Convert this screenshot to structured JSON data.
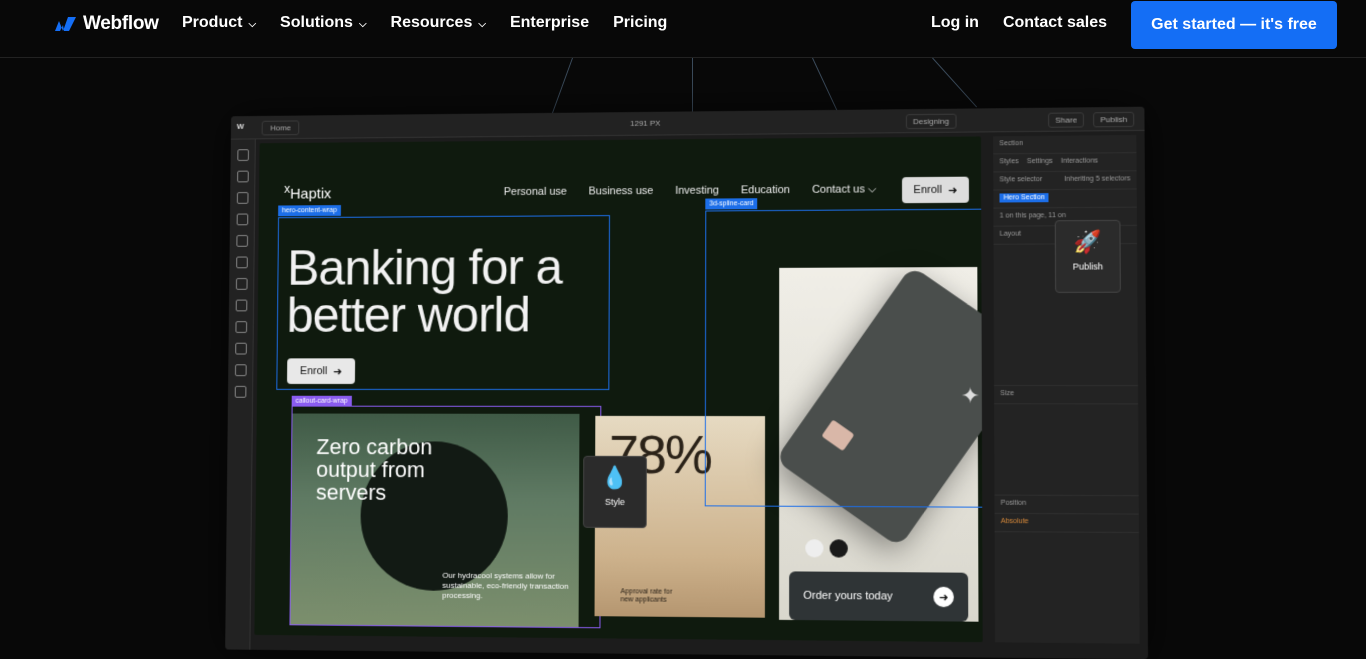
{
  "nav": {
    "brand": "Webflow",
    "items": [
      {
        "label": "Product",
        "has_menu": true
      },
      {
        "label": "Solutions",
        "has_menu": true
      },
      {
        "label": "Resources",
        "has_menu": true
      },
      {
        "label": "Enterprise",
        "has_menu": false
      },
      {
        "label": "Pricing",
        "has_menu": false
      }
    ],
    "login": "Log in",
    "contact": "Contact sales",
    "cta": "Get started — it's free"
  },
  "designer": {
    "page_tab": "Home",
    "width_readout": "1291 PX",
    "mode": "Designing",
    "share": "Share",
    "publish": "Publish",
    "panel": {
      "element": "Section",
      "tabs": [
        "Styles",
        "Settings",
        "Interactions"
      ],
      "style_selector": "Style selector",
      "inheriting": "Inheriting 5 selectors",
      "class_chip": "Hero Section",
      "on_page": "1 on this page, 11 on",
      "layout": "Layout",
      "size": "Size",
      "position": "Position",
      "position_value": "Absolute"
    }
  },
  "site": {
    "logo": "Haptix",
    "nav": [
      "Personal use",
      "Business use",
      "Investing",
      "Education",
      "Contact us"
    ],
    "enroll": "Enroll",
    "hero_title_1": "Banking for a",
    "hero_title_2": "better world",
    "hero_enroll": "Enroll",
    "card_title_1": "Zero carbon",
    "card_title_2": "output from",
    "card_title_3": "servers",
    "card_body": "Our hydracool systems allow for sustainable, eco-friendly transaction processing.",
    "percent": "78%",
    "approval_1": "Approval rate for",
    "approval_2": "new applicants",
    "order": "Order yours today",
    "style_label": "Style",
    "publish_label": "Publish"
  },
  "tags": {
    "hero": "hero-content-wrap",
    "callout": "callout-card-wrap",
    "spline": "3d-spline-card"
  },
  "colors": {
    "accent": "#146ef5",
    "select_blue": "#1c6ee8",
    "select_purple": "#8a5cf0"
  }
}
